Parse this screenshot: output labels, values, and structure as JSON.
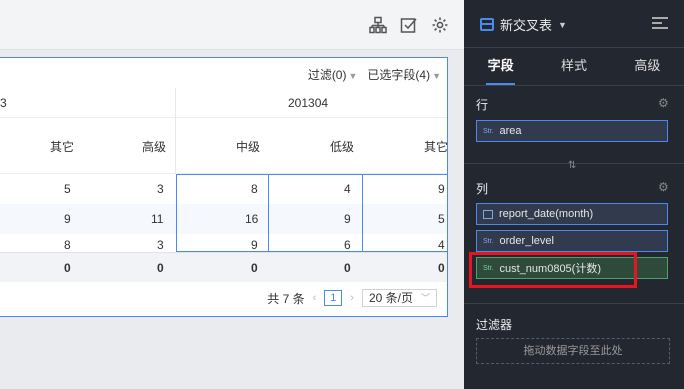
{
  "toolbar": {
    "icons": [
      "hierarchy-icon",
      "check-square-icon",
      "gear-icon"
    ]
  },
  "table": {
    "filter_label": "过滤(0)",
    "selected_fields_label": "已选字段(4)",
    "header_row1": [
      "3",
      "201304"
    ],
    "header_row2": [
      "其它",
      "高级",
      "中级",
      "低级",
      "其它"
    ],
    "rows": [
      [
        "5",
        "3",
        "8",
        "4",
        "9"
      ],
      [
        "9",
        "11",
        "16",
        "9",
        "5"
      ],
      [
        "8",
        "3",
        "9",
        "6",
        "4"
      ]
    ],
    "summary": [
      "0",
      "0",
      "0",
      "0",
      "0"
    ],
    "pager": {
      "total": "共 7 条",
      "current_page": "1",
      "page_size": "20 条/页"
    }
  },
  "panel": {
    "title": "新交叉表",
    "tabs": [
      "字段",
      "样式",
      "高级"
    ],
    "active_tab": "字段",
    "rows_label": "行",
    "row_fields": [
      {
        "type": "Str.",
        "name": "area"
      }
    ],
    "cols_label": "列",
    "col_fields": [
      {
        "type": "calendar",
        "name": "report_date(month)"
      },
      {
        "type": "Str.",
        "name": "order_level"
      },
      {
        "type": "Str.",
        "name": "cust_num0805(计数)"
      }
    ],
    "filter_label": "过滤器",
    "drop_hint": "拖动数据字段至此处",
    "colors": {
      "accent": "#4a8af0",
      "measure_green": "#4ba36c",
      "highlight_red": "#e8141e",
      "panel_bg": "#232730"
    }
  }
}
